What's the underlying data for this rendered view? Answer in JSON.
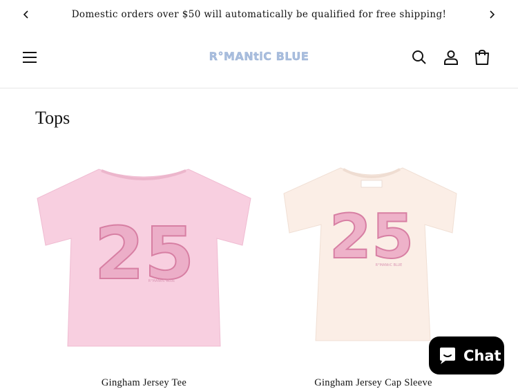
{
  "announcement": {
    "message": "Domestic orders over $50 will automatically be qualified for free shipping!",
    "prev_icon": "chevron-left-icon",
    "next_icon": "chevron-right-icon"
  },
  "header": {
    "logo_text": "R°MANtiC BLUE",
    "logo_color": "#a9bede",
    "icons": [
      "hamburger-menu-icon",
      "search-icon",
      "account-icon",
      "cart-icon"
    ]
  },
  "collection": {
    "title": "Tops",
    "products": [
      {
        "name": "Gingham Jersey Tee",
        "shirt_color": "#f8cfe0",
        "print_text": "25",
        "print_color": "#e39ab8"
      },
      {
        "name": "Gingham Jersey Cap Sleeve",
        "shirt_color": "#fbeee6",
        "print_text": "25",
        "print_color": "#e39ab8"
      }
    ]
  },
  "chat": {
    "label": "Chat",
    "icon": "chat-bubble-icon"
  }
}
